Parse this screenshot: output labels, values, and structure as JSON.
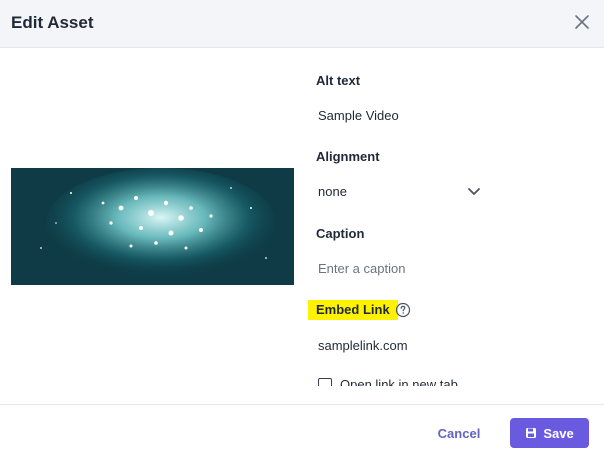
{
  "dialog": {
    "title": "Edit Asset",
    "close_icon": "close-icon"
  },
  "media": {
    "kind": "video-thumbnail",
    "description_colors": [
      "#0d3d47",
      "#1b6b73",
      "#e6ffff"
    ]
  },
  "fields": {
    "alt_text": {
      "label": "Alt text",
      "value": "Sample Video"
    },
    "alignment": {
      "label": "Alignment",
      "value": "none",
      "icon": "chevron-down-icon"
    },
    "caption": {
      "label": "Caption",
      "placeholder": "Enter a caption"
    },
    "embed_link": {
      "label": "Embed Link",
      "value": "samplelink.com",
      "help_icon": "help-circle-icon",
      "highlight": "#fff200"
    },
    "open_new_tab": {
      "label": "Open link in new tab",
      "checked": false
    }
  },
  "footer": {
    "cancel_label": "Cancel",
    "save_label": "Save",
    "save_icon": "save-icon",
    "accent": "#6a5ae0"
  }
}
